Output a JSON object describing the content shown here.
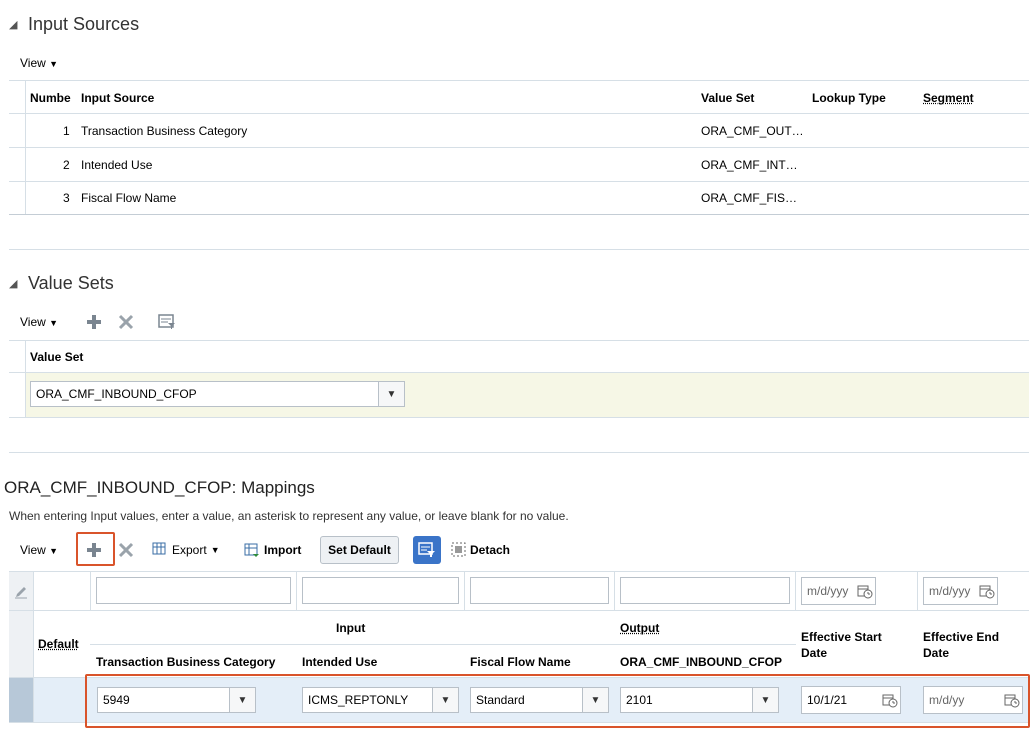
{
  "input_sources": {
    "title": "Input Sources",
    "view_label": "View",
    "columns": [
      "Numbe",
      "Input Source",
      "Value Set",
      "Lookup Type",
      "Segment"
    ],
    "rows": [
      {
        "num": "1",
        "source": "Transaction Business Category",
        "value_set": "ORA_CMF_OUT…"
      },
      {
        "num": "2",
        "source": "Intended Use",
        "value_set": "ORA_CMF_INT…"
      },
      {
        "num": "3",
        "source": "Fiscal Flow Name",
        "value_set": "ORA_CMF_FIS…"
      }
    ]
  },
  "value_sets": {
    "title": "Value Sets",
    "view_label": "View",
    "column": "Value Set",
    "selected": "ORA_CMF_INBOUND_CFOP"
  },
  "mappings": {
    "title": "ORA_CMF_INBOUND_CFOP: Mappings",
    "hint": "When entering Input values, enter a value, an asterisk to represent any value, or leave blank for no value.",
    "view_label": "View",
    "export_label": "Export",
    "import_label": "Import",
    "set_default_label": "Set Default",
    "detach_label": "Detach",
    "date_placeholder_filter": "m/d/yyy",
    "group_input": "Input",
    "group_output": "Output",
    "col_default": "Default",
    "col_tbc": "Transaction Business Category",
    "col_intended": "Intended Use",
    "col_fiscal": "Fiscal Flow Name",
    "col_output": "ORA_CMF_INBOUND_CFOP",
    "col_start_1": "Effective Start",
    "col_start_2": "Date",
    "col_end_1": "Effective End",
    "col_end_2": "Date",
    "row": {
      "tbc": "5949",
      "intended": "ICMS_REPTONLY",
      "fiscal": "Standard",
      "output": "2101",
      "start": "10/1/21",
      "end_placeholder": "m/d/yy"
    }
  }
}
